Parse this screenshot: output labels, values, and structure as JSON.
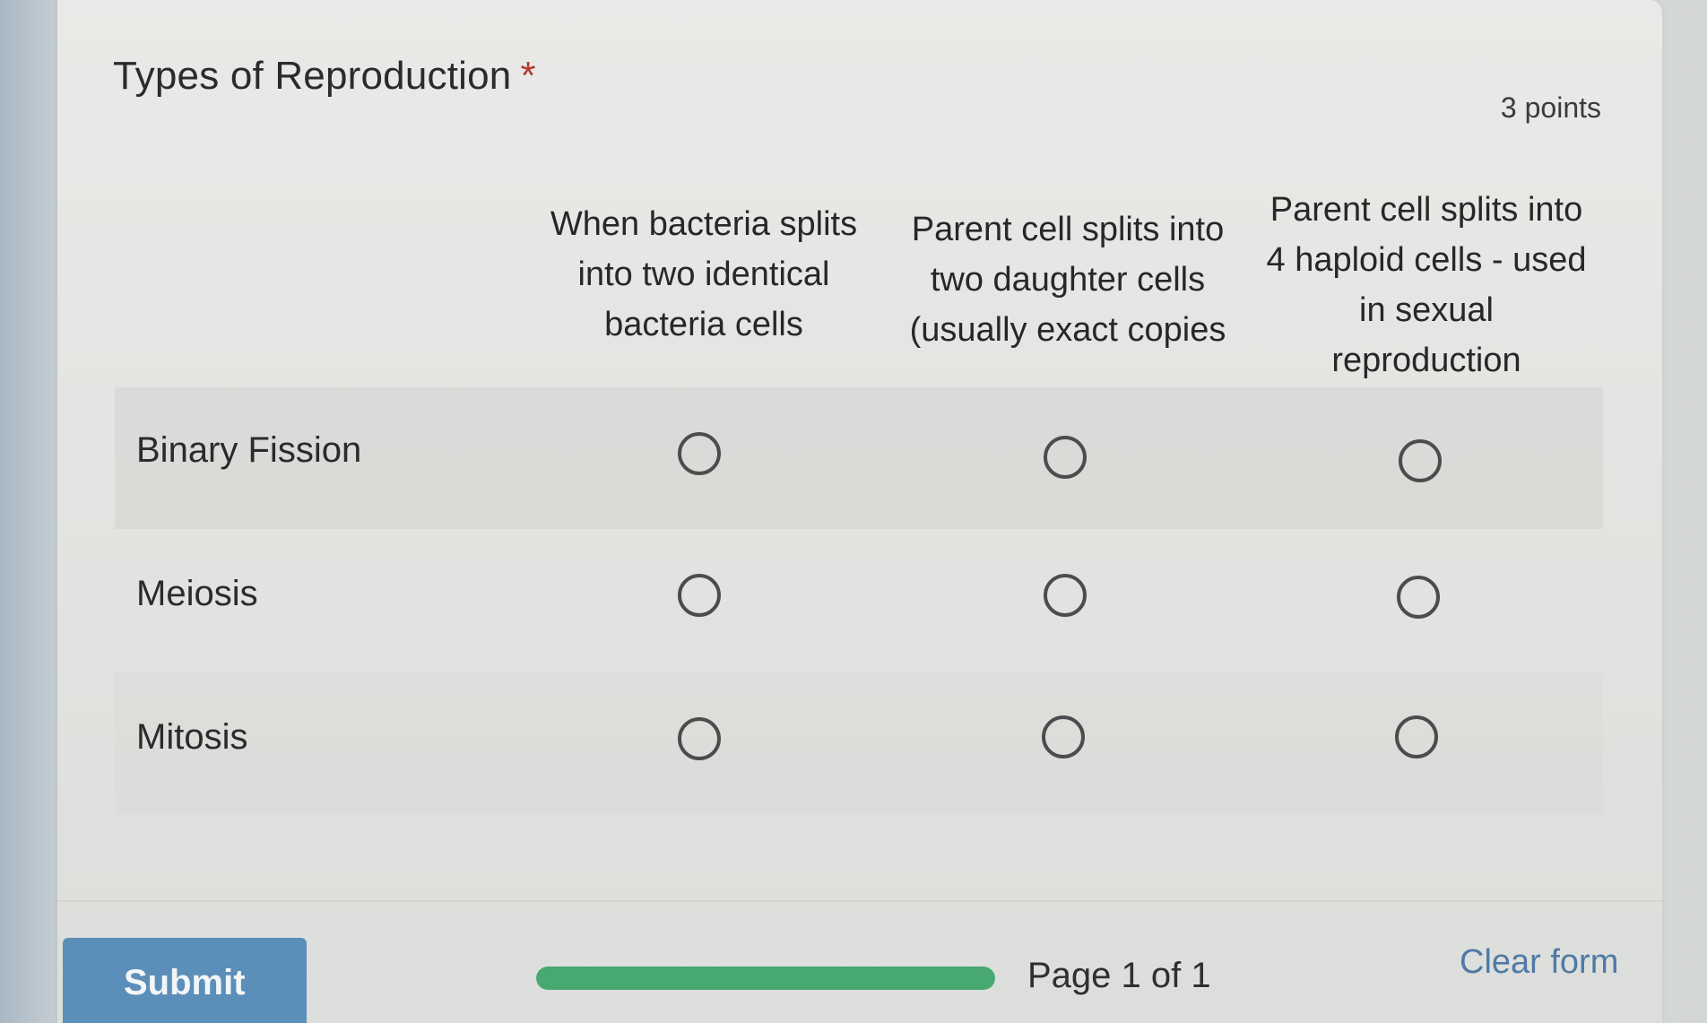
{
  "question": {
    "title": "Types of Reproduction",
    "required_marker": "*",
    "points": "3 points"
  },
  "columns": [
    [
      "When bacteria splits",
      "into two identical",
      "bacteria cells"
    ],
    [
      "Parent cell splits into",
      "two daughter cells",
      "(usually exact copies"
    ],
    [
      "Parent cell splits into",
      "4 haploid cells - used",
      "in sexual",
      "reproduction"
    ]
  ],
  "rows": [
    {
      "label": "Binary Fission"
    },
    {
      "label": "Meiosis"
    },
    {
      "label": "Mitosis"
    }
  ],
  "footer": {
    "submit_label": "Submit",
    "progress_fraction": 1.0,
    "page_indicator": "Page 1 of 1",
    "clear_label": "Clear form"
  },
  "colors": {
    "accent": "#5b8fb9",
    "progress": "#47a872",
    "required": "#b53a2f",
    "link": "#4f7aa6"
  }
}
